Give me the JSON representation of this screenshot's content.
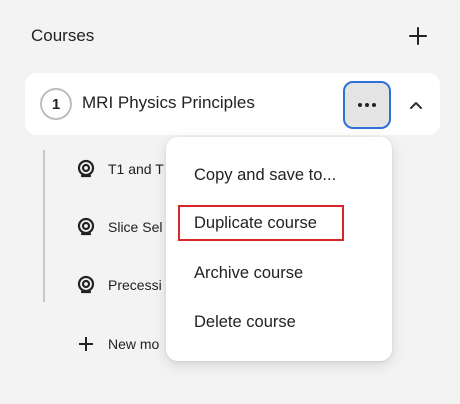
{
  "header": {
    "title": "Courses"
  },
  "course": {
    "number": "1",
    "title": "MRI Physics Principles"
  },
  "modules": [
    {
      "label": "T1 and T"
    },
    {
      "label": "Slice Sel"
    },
    {
      "label": "Precessi"
    }
  ],
  "new_module": {
    "label": "New mo"
  },
  "menu": {
    "items": [
      {
        "label": "Copy and save to..."
      },
      {
        "label": "Duplicate course"
      },
      {
        "label": "Archive course"
      },
      {
        "label": "Delete course"
      }
    ]
  },
  "colors": {
    "focus_ring": "#2f6fd6",
    "highlight": "#d9252a"
  }
}
